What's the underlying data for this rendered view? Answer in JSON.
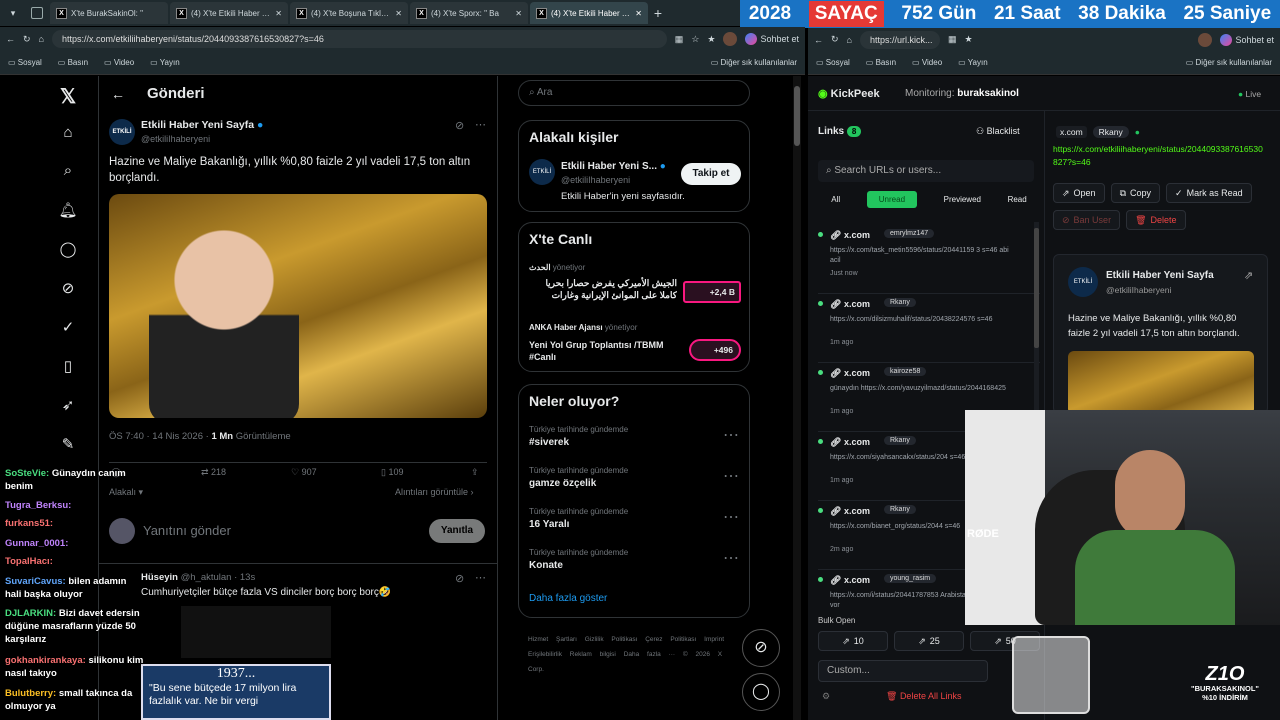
{
  "tabs": [
    {
      "label": "X'te BurakSakinOl: \""
    },
    {
      "label": "(4) X'te Etkili Haber Yen"
    },
    {
      "label": "(4) X'te Boşuna Tıklama"
    },
    {
      "label": "(4) X'te Sporx: \" Ba"
    },
    {
      "label": "(4) X'te Etkili Haber Yen"
    }
  ],
  "countdown": {
    "year": "2028",
    "title": "SAYAÇ",
    "days": "752 Gün",
    "hours": "21 Saat",
    "minutes": "38 Dakika",
    "seconds": "25 Saniye"
  },
  "left_browser": {
    "url": "https://x.com/etkiliihaberyeni/status/2044093387616530827?s=46",
    "profile_label": "Sohbet et"
  },
  "right_browser": {
    "url": "https://url.kick...",
    "profile_label": "Sohbet et"
  },
  "bookmarks": [
    "Sosyal",
    "Basın",
    "Video",
    "Yayın"
  ],
  "bookmarks_other": "Diğer sık kullanılanlar",
  "post": {
    "header": "Gönderi",
    "author": "Etkili Haber Yeni Sayfa",
    "handle": "@etkiliIhaberyeni",
    "text": "Hazine ve Maliye Bakanlığı, yıllık %0,80 faizle 2 yıl vadeli 17,5 ton altın borçlandı.",
    "meta_time": "ÖS 7:40 · 14 Nis 2026 · ",
    "views": "1 Mn",
    "views_label": " Görüntüleme",
    "reposts": "218",
    "likes": "907",
    "bookmarks": "109",
    "sort_label": "Alakalı",
    "quotes_label": "Alıntıları görüntüle",
    "reply_placeholder": "Yanıtını gönder",
    "reply_button": "Yanıtla",
    "reply_author": "Hüseyin",
    "reply_handle": "@h_aktulan · 13s",
    "reply_text": "Cumhuriyetçiler bütçe fazla VS dinciler borç borç borç🤣"
  },
  "search_placeholder": "Ara",
  "relevant": {
    "title": "Alakalı kişiler",
    "name": "Etkili Haber Yeni S...",
    "handle": "@etkiliIhaberyeni",
    "bio": "Etkili Haber'in yeni sayfasıdır.",
    "follow": "Takip et"
  },
  "live": {
    "title": "X'te Canlı",
    "items": [
      {
        "host": "الحدث",
        "role": "yönetiyor",
        "title": "الجيش الأميركي يفرض حصارا بحريا كاملا على الموانئ الإيرانية وغارات",
        "count": "+2,4 B"
      },
      {
        "host": "ANKA Haber Ajansı",
        "role": "yönetiyor",
        "title": "Yeni Yol Grup Toplantısı /TBMM #Canlı",
        "count": "+496"
      }
    ]
  },
  "trends": {
    "title": "Neler oluyor?",
    "items": [
      {
        "context": "Türkiye tarihinde gündemde",
        "name": "#siverek"
      },
      {
        "context": "Türkiye tarihinde gündemde",
        "name": "gamze özçelik"
      },
      {
        "context": "Türkiye tarihinde gündemde",
        "name": "16 Yaralı"
      },
      {
        "context": "Türkiye tarihinde gündemde",
        "name": "Konate"
      }
    ],
    "more": "Daha fazla göster"
  },
  "footer": [
    "Hizmet Şartları",
    "Gizlilik Politikası",
    "Çerez Politikası",
    "Imprint",
    "Erişilebilirlik",
    "Reklam bilgisi",
    "Daha fazla ···",
    "© 2026 X Corp."
  ],
  "kickpeek": {
    "app": "KickPeek",
    "monitoring_label": "Monitoring: ",
    "monitoring_user": "buraksakinol",
    "status": "Live",
    "links_title": "Links",
    "links_count": "8",
    "blacklist": "Blacklist",
    "search_placeholder": "Search URLs or users...",
    "filters": [
      "All",
      "Unread",
      "Previewed",
      "Read"
    ],
    "items": [
      {
        "domain": "x.com",
        "user": "emrylmz147",
        "url": "https://x.com/task_metin5596/status/20441159 3 s=46 abi acil",
        "time": "Just now"
      },
      {
        "domain": "x.com",
        "user": "Rkany",
        "url": "https://x.com/dilsizmuhalif/status/20438224576 s=46",
        "time": "1m ago"
      },
      {
        "domain": "x.com",
        "user": "kairoze58",
        "url": "günaydın https://x.com/yavuzyilmazd/status/2044168425",
        "time": "1m ago"
      },
      {
        "domain": "x.com",
        "user": "Rkany",
        "url": "https://x.com/siyahsancakx/status/204 s=46",
        "time": "1m ago"
      },
      {
        "domain": "x.com",
        "user": "Rkany",
        "url": "https://x.com/bianet_org/status/2044 s=46",
        "time": "2m ago"
      },
      {
        "domain": "x.com",
        "user": "young_rasim",
        "url": "https://x.com/i/status/20441787853 Arabistan Çin'e vanasıvor",
        "time": ""
      }
    ],
    "bulk_open": "Bulk Open",
    "bulk": [
      "10",
      "25",
      "50"
    ],
    "custom_placeholder": "Custom...",
    "delete_all": "Delete All Links",
    "detail": {
      "domain": "x.com",
      "user": "Rkany",
      "url": "https://x.com/etkiliihaberyeni/status/2044093387616530827?s=46",
      "open": "Open",
      "copy": "Copy",
      "mark": "Mark as Read",
      "ban": "Ban User",
      "delete": "Delete",
      "author": "Etkili Haber Yeni Sayfa",
      "handle": "@etkiliIhaberyeni",
      "text": "Hazine ve Maliye Bakanlığı, yıllık %0,80 faizle 2 yıl vadeli 17,5 ton altın borçlandı."
    }
  },
  "chat": [
    {
      "user": "SoSteVie:",
      "msg": "Günaydın canım benim"
    },
    {
      "user": "Tugra_Berksu:",
      "msg": ""
    },
    {
      "user": "furkans51:",
      "msg": ""
    },
    {
      "user": "Gunnar_0001:",
      "msg": ""
    },
    {
      "user": "TopalHacı:",
      "msg": ""
    },
    {
      "user": "SuvariCavus:",
      "msg": "bilen adamın hali başka oluyor"
    },
    {
      "user": "DJLARKIN:",
      "msg": "Bizi davet edersin düğüne masrafların yüzde 50 karşılarız"
    },
    {
      "user": "gokhankirankaya:",
      "msg": "silikonu kim nasıl takıyo"
    },
    {
      "user": "Bulutberry:",
      "msg": "small takınca da olmuyor ya"
    }
  ],
  "banner": {
    "year": "1937...",
    "quote": "\"Bu sene bütçede 17 milyon lira fazlalık var. Ne bir vergi"
  },
  "sponsor": {
    "brand": "Z1O",
    "code": "\"BURAKSAKINOL\"",
    "discount": "%10 İNDİRİM"
  },
  "colors": {
    "accent": "#1d9bf0",
    "kick_green": "#53fc18",
    "live_green": "#22c55e",
    "countdown_blue": "#1a73c4",
    "countdown_red": "#e53935"
  }
}
